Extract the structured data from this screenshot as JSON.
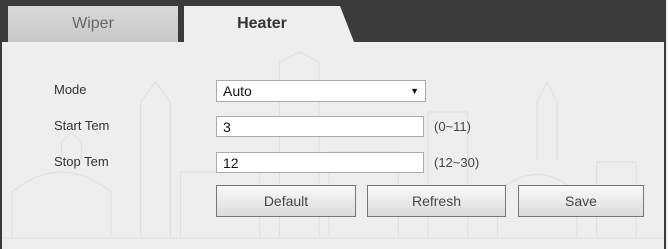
{
  "tabs": [
    {
      "label": "Wiper",
      "active": false
    },
    {
      "label": "Heater",
      "active": true
    }
  ],
  "form": {
    "mode": {
      "label": "Mode",
      "value": "Auto"
    },
    "start_temp": {
      "label": "Start Tem",
      "value": "3",
      "range": "(0~11)"
    },
    "stop_temp": {
      "label": "Stop Tem",
      "value": "12",
      "range": "(12~30)"
    }
  },
  "buttons": {
    "default_label": "Default",
    "refresh_label": "Refresh",
    "save_label": "Save"
  },
  "colors": {
    "tab_bar": "#3b3b3b",
    "panel": "#eeeeee",
    "button_border": "#777777"
  }
}
